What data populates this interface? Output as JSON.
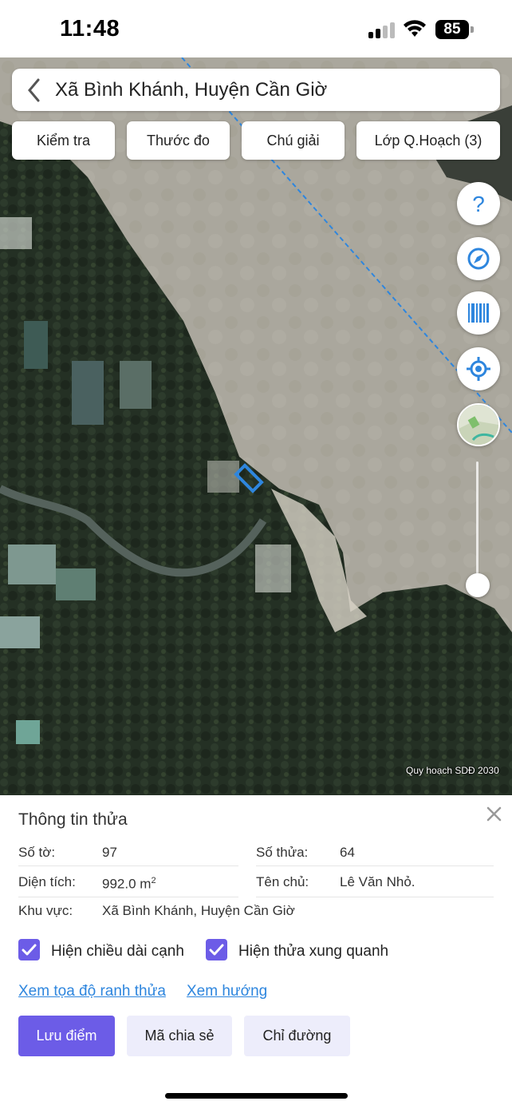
{
  "status_bar": {
    "time": "11:48",
    "battery": "85"
  },
  "header": {
    "title": "Xã Bình Khánh, Huyện Cần Giờ"
  },
  "toolbar": {
    "check_label": "Kiểm tra",
    "measure_label": "Thước đo",
    "legend_label": "Chú giải",
    "layers_label": "Lớp Q.Hoạch (3)"
  },
  "map": {
    "icons": [
      "help-icon",
      "compass-icon",
      "barcode-icon",
      "locate-icon",
      "map-layer-icon"
    ],
    "attribution": "Quy hoạch SDĐ 2030",
    "accent_color": "#2e86de"
  },
  "parcel": {
    "title": "Thông tin thửa",
    "sheet_label": "Số tờ:",
    "sheet_value": "97",
    "parcel_label": "Số thửa:",
    "parcel_value": "64",
    "area_label": "Diện tích:",
    "area_value": "992.0 m",
    "area_unit_sup": "2",
    "owner_label": "Tên chủ:",
    "owner_value": "Lê Văn Nhỏ.",
    "region_label": "Khu vực:",
    "region_value": "Xã Bình Khánh, Huyện Cần Giờ"
  },
  "options": {
    "show_edge_length": {
      "label": "Hiện chiều dài cạnh",
      "checked": true
    },
    "show_neighbors": {
      "label": "Hiện thửa xung quanh",
      "checked": true
    }
  },
  "links": {
    "view_coordinates": "Xem tọa độ ranh thửa",
    "view_direction": "Xem hướng"
  },
  "actions": {
    "save_label": "Lưu điểm",
    "share_label": "Mã chia sẻ",
    "directions_label": "Chỉ đường"
  },
  "colors": {
    "primary": "#6c5ce7",
    "secondary_bg": "#ededfb",
    "link": "#2e86de"
  }
}
